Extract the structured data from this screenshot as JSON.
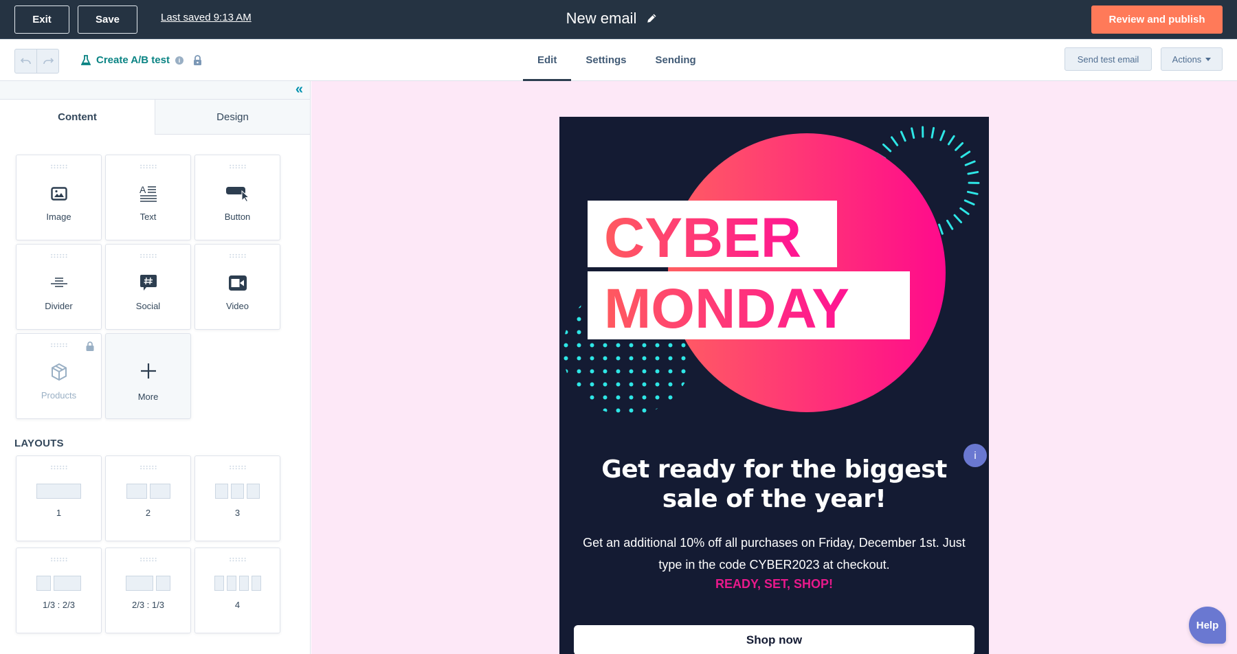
{
  "topbar": {
    "exit_label": "Exit",
    "save_label": "Save",
    "last_saved": "Last saved 9:13 AM",
    "title": "New email",
    "review_label": "Review and publish",
    "accent_color": "#ff7a59"
  },
  "subbar": {
    "undo_icon": "undo-icon",
    "redo_icon": "redo-icon",
    "ab_test_label": "Create A/B test",
    "tabs": [
      {
        "label": "Edit",
        "active": true
      },
      {
        "label": "Settings",
        "active": false
      },
      {
        "label": "Sending",
        "active": false
      }
    ],
    "send_test_label": "Send test email",
    "actions_label": "Actions"
  },
  "sidebar": {
    "tabs": [
      {
        "label": "Content",
        "active": true
      },
      {
        "label": "Design",
        "active": false
      }
    ],
    "modules": [
      {
        "label": "Image",
        "icon": "image-icon"
      },
      {
        "label": "Text",
        "icon": "text-icon"
      },
      {
        "label": "Button",
        "icon": "button-icon"
      },
      {
        "label": "Divider",
        "icon": "divider-icon"
      },
      {
        "label": "Social",
        "icon": "social-icon"
      },
      {
        "label": "Video",
        "icon": "video-icon"
      },
      {
        "label": "Products",
        "icon": "box-icon",
        "locked": true
      },
      {
        "label": "More",
        "icon": "plus-icon"
      }
    ],
    "layouts_heading": "LAYOUTS",
    "layouts": [
      {
        "label": "1"
      },
      {
        "label": "2"
      },
      {
        "label": "3"
      },
      {
        "label": "1/3 : 2/3"
      },
      {
        "label": "2/3 : 1/3"
      },
      {
        "label": "4"
      }
    ]
  },
  "email": {
    "hero_line1": "CYBER",
    "hero_line2": "MONDAY",
    "headline": "Get ready for the biggest sale of the year!",
    "body": "Get an additional 10% off all purchases on Friday, December 1st. Just type in the code CYBER2023 at checkout.",
    "tagline": "READY, SET, SHOP!",
    "cta_label": "Shop now",
    "bg_color": "#141b33",
    "accent_pink": "#e8198b",
    "accent_cyan": "#2ee6e6"
  },
  "info_badge": "i",
  "help_label": "Help"
}
